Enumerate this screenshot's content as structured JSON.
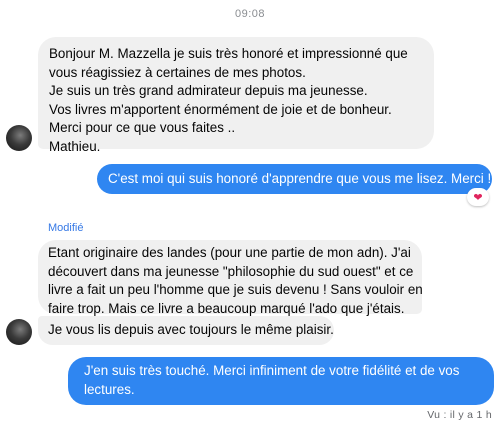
{
  "header": {
    "time": "09:08"
  },
  "messages": [
    {
      "id": "b1",
      "lines": [
        "Bonjour M. Mazzella je suis très honoré et impressionné que",
        "vous réagissiez à certaines de mes photos.",
        "Je suis un très grand admirateur depuis ma jeunesse.",
        "Vos livres m'apportent énormément de joie et de bonheur.",
        "Merci pour ce que vous faites ..",
        "Mathieu."
      ]
    },
    {
      "id": "b2",
      "lines": [
        "C'est moi qui suis honoré d'apprendre que vous me lisez. Merci !"
      ],
      "reaction": "❤"
    },
    {
      "id": "b3",
      "edited_label": "Modifié",
      "lines": [
        "Etant originaire des landes (pour une partie de mon adn). J'ai",
        "découvert dans ma jeunesse \"philosophie du sud ouest\" et ce",
        "livre a fait un peu l'homme que je suis devenu ! Sans vouloir en",
        "faire trop. Mais ce livre a beaucoup marqué l'ado que j'étais."
      ]
    },
    {
      "id": "b4",
      "lines": [
        "Je vous lis depuis avec toujours le même plaisir."
      ]
    },
    {
      "id": "b5",
      "lines": [
        "J'en suis très touché. Merci infiniment de votre fidélité et de vos",
        "lectures."
      ]
    }
  ],
  "status": {
    "seen": "Vu : il y a 1 h"
  },
  "colors": {
    "outgoing_bubble": "#2f86f1",
    "incoming_bubble": "#f0f0f0",
    "edited_label": "#3578e5",
    "reaction": "#e0245e"
  },
  "icons": {
    "avatar": "contact-avatar",
    "reaction": "heart-icon"
  }
}
